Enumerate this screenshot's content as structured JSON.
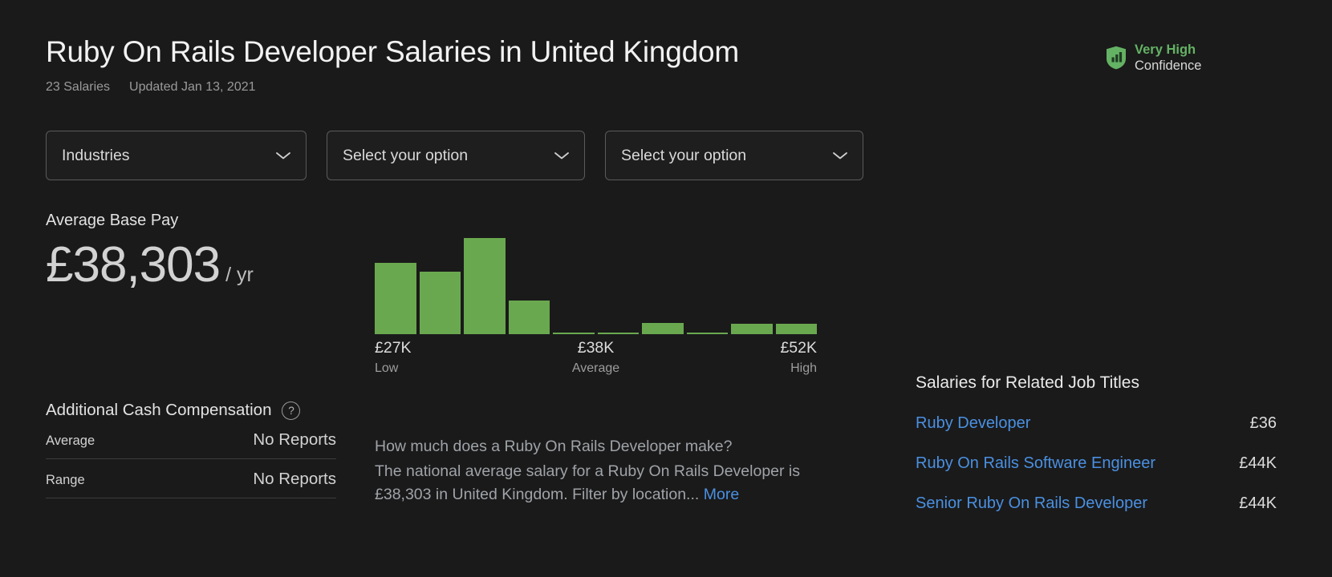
{
  "header": {
    "title": "Ruby On Rails Developer Salaries in United Kingdom",
    "salary_count": "23 Salaries",
    "updated": "Updated Jan 13, 2021"
  },
  "confidence": {
    "level": "Very High",
    "label": "Confidence",
    "icon": "shield-bar-chart-icon",
    "color": "#64b264"
  },
  "filters": [
    {
      "label": "Industries",
      "icon": "chevron-down-icon"
    },
    {
      "label": "Select your option",
      "icon": "chevron-down-icon"
    },
    {
      "label": "Select your option",
      "icon": "chevron-down-icon"
    }
  ],
  "base_pay": {
    "title": "Average Base Pay",
    "amount": "£38,303",
    "unit": "/ yr"
  },
  "chart_data": {
    "type": "bar",
    "title": "Base pay distribution",
    "xlabel": "",
    "ylabel": "",
    "grid": false,
    "legend": null,
    "categories": [
      "b1",
      "b2",
      "b3",
      "b4",
      "b5",
      "b6",
      "b7",
      "b8",
      "b9",
      "b10"
    ],
    "values": [
      89,
      78,
      120,
      42,
      2,
      2,
      14,
      2,
      13,
      13
    ],
    "ylim": [
      0,
      135
    ],
    "bar_color": "#6aa84f",
    "axis_labels": [
      {
        "value": "£27K",
        "caption": "Low"
      },
      {
        "value": "£38K",
        "caption": "Average"
      },
      {
        "value": "£52K",
        "caption": "High"
      }
    ]
  },
  "additional_cash": {
    "title": "Additional Cash Compensation",
    "help_icon": "question-mark-icon",
    "rows": [
      {
        "key": "Average",
        "value": "No Reports"
      },
      {
        "key": "Range",
        "value": "No Reports"
      }
    ]
  },
  "faq": {
    "question": "How much does a Ruby On Rails Developer make?",
    "answer": "The national average salary for a Ruby On Rails Developer is £38,303 in United Kingdom. Filter by location...",
    "more_label": "More"
  },
  "related": {
    "title": "Salaries for Related Job Titles",
    "rows": [
      {
        "title": "Ruby Developer",
        "amount": "£36"
      },
      {
        "title": "Ruby On Rails Software Engineer",
        "amount": "£44K"
      },
      {
        "title": "Senior Ruby On Rails Developer",
        "amount": "£44K"
      }
    ]
  }
}
